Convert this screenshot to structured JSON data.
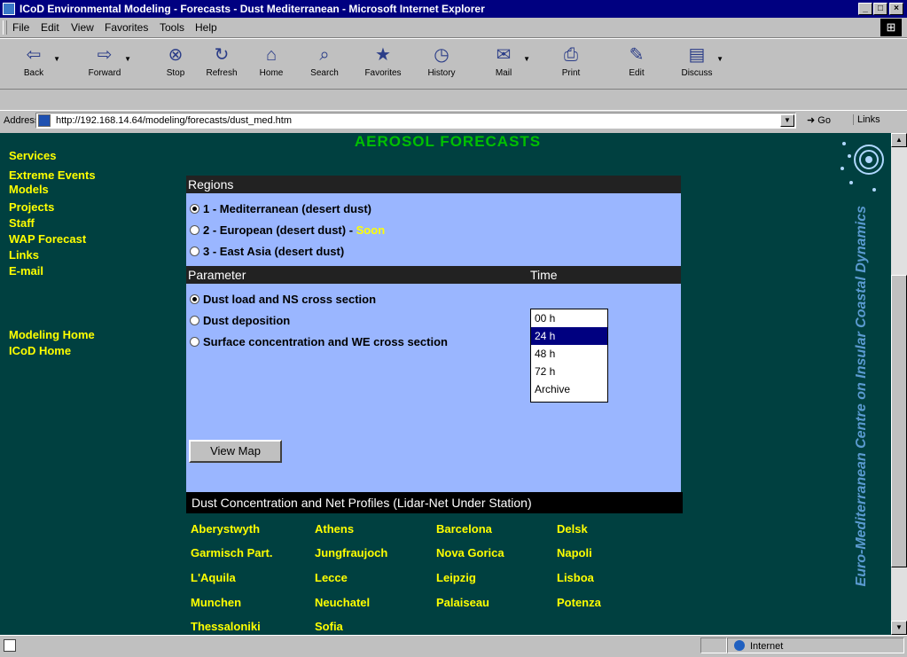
{
  "window": {
    "title": "ICoD Environmental Modeling - Forecasts - Dust Mediterranean - Microsoft Internet Explorer"
  },
  "menu": [
    "File",
    "Edit",
    "View",
    "Favorites",
    "Tools",
    "Help"
  ],
  "toolbar": [
    {
      "label": "Back",
      "icon": "back-arrow-icon"
    },
    {
      "label": "Forward",
      "icon": "forward-arrow-icon"
    },
    {
      "label": "Stop",
      "icon": "stop-icon"
    },
    {
      "label": "Refresh",
      "icon": "refresh-icon"
    },
    {
      "label": "Home",
      "icon": "home-icon"
    },
    {
      "label": "Search",
      "icon": "search-icon"
    },
    {
      "label": "Favorites",
      "icon": "favorites-icon"
    },
    {
      "label": "History",
      "icon": "history-icon"
    },
    {
      "label": "Mail",
      "icon": "mail-icon"
    },
    {
      "label": "Print",
      "icon": "print-icon"
    },
    {
      "label": "Edit",
      "icon": "edit-icon"
    },
    {
      "label": "Discuss",
      "icon": "discuss-icon"
    }
  ],
  "address": {
    "label": "Address",
    "url": "http://192.168.14.64/modeling/forecasts/dust_med.htm",
    "go": "Go",
    "links": "Links"
  },
  "nav": [
    "Services",
    "Extreme Events",
    "Models",
    "Projects",
    "Staff",
    "WAP Forecast",
    "Links",
    "E-mail",
    "Modeling Home",
    "ICoD Home"
  ],
  "heading": "AEROSOL FORECASTS",
  "regions": {
    "header": "Regions",
    "options": [
      {
        "label": "1 - Mediterranean (desert dust)",
        "checked": true,
        "note": ""
      },
      {
        "label": "2 - European (desert dust) - ",
        "checked": false,
        "note": "Soon"
      },
      {
        "label": "3 - East Asia (desert dust)",
        "checked": false,
        "note": ""
      }
    ]
  },
  "parameter": {
    "header": "Parameter",
    "time_header": "Time",
    "options": [
      {
        "label": "Dust load and NS cross section",
        "checked": true
      },
      {
        "label": "Dust deposition",
        "checked": false
      },
      {
        "label": "Surface concentration and WE cross section",
        "checked": false
      }
    ]
  },
  "time_options": [
    "00 h",
    "24 h",
    "48 h",
    "72 h",
    "Archive"
  ],
  "time_selected": "24 h",
  "view_map": "View Map",
  "profiles_title": "Dust Concentration and Net Profiles (Lidar-Net Under Station)",
  "stations": [
    [
      "Aberystwyth",
      "Athens",
      "Barcelona",
      "Delsk"
    ],
    [
      "Garmisch Part.",
      "Jungfraujoch",
      "Nova Gorica",
      "Napoli"
    ],
    [
      "L'Aquila",
      "Lecce",
      "Leipzig",
      "Lisboa"
    ],
    [
      "Munchen",
      "Neuchatel",
      "Palaiseau",
      "Potenza"
    ],
    [
      "Thessaloniki",
      "Sofia",
      "",
      ""
    ]
  ],
  "logo_text": "Euro-Mediterranean Centre on Insular Coastal Dynamics",
  "status": {
    "zone": "Internet"
  },
  "colors": {
    "page_bg": "#004040",
    "panel_bg": "#9ab6ff",
    "link": "#ffff00",
    "heading": "#00c000"
  }
}
